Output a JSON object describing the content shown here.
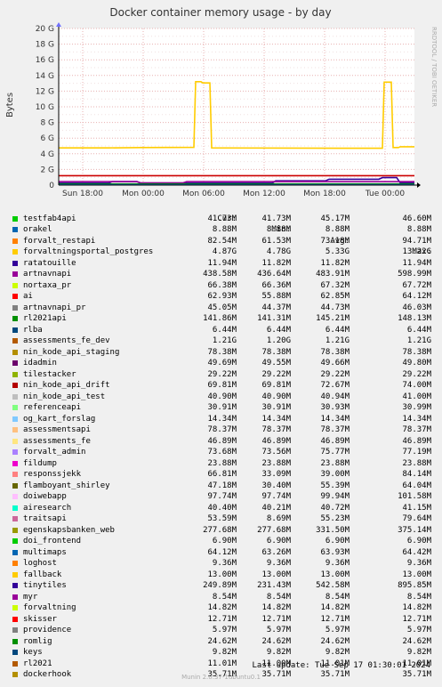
{
  "chart_data": {
    "type": "line",
    "title": "Docker container memory usage - by day",
    "ylabel": "Bytes",
    "side_label": "RRDTOOL / TOBI OETIKER",
    "ylim": [
      0,
      20
    ],
    "y_unit": "G",
    "y_ticks": [
      {
        "v": 0,
        "label": "0"
      },
      {
        "v": 2,
        "label": "2 G"
      },
      {
        "v": 4,
        "label": "4 G"
      },
      {
        "v": 6,
        "label": "6 G"
      },
      {
        "v": 8,
        "label": "8 G"
      },
      {
        "v": 10,
        "label": "10 G"
      },
      {
        "v": 12,
        "label": "12 G"
      },
      {
        "v": 14,
        "label": "14 G"
      },
      {
        "v": 16,
        "label": "16 G"
      },
      {
        "v": 18,
        "label": "18 G"
      },
      {
        "v": 20,
        "label": "20 G"
      }
    ],
    "x_range": [
      "Mon 15:30",
      "Tue 01:30"
    ],
    "x_ticks": [
      {
        "t": "Sun 18:00",
        "label": "Sun 18:00"
      },
      {
        "t": "Mon 00:00",
        "label": "Mon 00:00"
      },
      {
        "t": "Mon 06:00",
        "label": "Mon 06:00"
      },
      {
        "t": "Mon 12:00",
        "label": "Mon 12:00"
      },
      {
        "t": "Mon 18:00",
        "label": "Mon 18:00"
      },
      {
        "t": "Tue 00:00",
        "label": "Tue 00:00"
      }
    ],
    "series": [
      {
        "name": "forvaltningsportal_postgres",
        "color": "#ffcc00",
        "points": [
          [
            0,
            4.75
          ],
          [
            0.14,
            4.75
          ],
          [
            0.23,
            4.8
          ],
          [
            0.38,
            4.82
          ],
          [
            0.385,
            13.2
          ],
          [
            0.4,
            13.2
          ],
          [
            0.405,
            13.05
          ],
          [
            0.425,
            13.05
          ],
          [
            0.43,
            4.75
          ],
          [
            0.8,
            4.7
          ],
          [
            0.91,
            4.7
          ],
          [
            0.915,
            13.15
          ],
          [
            0.935,
            13.15
          ],
          [
            0.94,
            4.8
          ],
          [
            0.955,
            4.8
          ],
          [
            0.96,
            4.9
          ],
          [
            1,
            4.9
          ]
        ]
      },
      {
        "name": "romlig",
        "color": "#cc0000",
        "points": [
          [
            0,
            1.21
          ],
          [
            1,
            1.21
          ]
        ]
      },
      {
        "name": "tinytiles",
        "color": "#330099",
        "points": [
          [
            0,
            0.25
          ],
          [
            0.14,
            0.25
          ],
          [
            0.15,
            0.45
          ],
          [
            0.22,
            0.45
          ],
          [
            0.23,
            0.25
          ],
          [
            0.6,
            0.25
          ],
          [
            0.61,
            0.55
          ],
          [
            0.75,
            0.55
          ],
          [
            0.76,
            0.75
          ],
          [
            0.9,
            0.75
          ],
          [
            0.91,
            0.95
          ],
          [
            0.95,
            0.95
          ],
          [
            0.96,
            0.3
          ],
          [
            1,
            0.3
          ]
        ]
      },
      {
        "name": "artnavnapi",
        "color": "#990099",
        "points": [
          [
            0,
            0.44
          ],
          [
            0.22,
            0.44
          ],
          [
            0.23,
            0.3
          ],
          [
            0.35,
            0.3
          ],
          [
            0.36,
            0.44
          ],
          [
            1,
            0.44
          ]
        ]
      },
      {
        "name": "rl2021api",
        "color": "#008000",
        "points": [
          [
            0,
            0.15
          ],
          [
            1,
            0.15
          ]
        ]
      },
      {
        "name": "orakel",
        "color": "#0066b3",
        "points": [
          [
            0,
            0.05
          ],
          [
            1,
            0.05
          ]
        ]
      }
    ],
    "legend": {
      "headers": [
        "Cur:",
        "Min:",
        "Avg:",
        "Max:"
      ],
      "rows": [
        {
          "name": "testfab4api",
          "color": "#00cc00",
          "cur": "41.73M",
          "min": "41.73M",
          "avg": "45.17M",
          "max": "46.60M"
        },
        {
          "name": "orakel",
          "color": "#0066b3",
          "cur": "8.88M",
          "min": "8.88M",
          "avg": "8.88M",
          "max": "8.88M"
        },
        {
          "name": "forvalt_restapi",
          "color": "#ff8000",
          "cur": "82.54M",
          "min": "61.53M",
          "avg": "73.18M",
          "max": "94.71M"
        },
        {
          "name": "forvaltningsportal_postgres",
          "color": "#ffcc00",
          "cur": "4.87G",
          "min": "4.78G",
          "avg": "5.33G",
          "max": "13.22G"
        },
        {
          "name": "ratatouille",
          "color": "#330099",
          "cur": "11.94M",
          "min": "11.82M",
          "avg": "11.82M",
          "max": "11.94M"
        },
        {
          "name": "artnavnapi",
          "color": "#990099",
          "cur": "438.58M",
          "min": "436.64M",
          "avg": "483.91M",
          "max": "598.99M"
        },
        {
          "name": "nortaxa_pr",
          "color": "#ccff00",
          "cur": "66.38M",
          "min": "66.36M",
          "avg": "67.32M",
          "max": "67.72M"
        },
        {
          "name": "ai",
          "color": "#ff0000",
          "cur": "62.93M",
          "min": "55.88M",
          "avg": "62.85M",
          "max": "64.12M"
        },
        {
          "name": "artnavnapi_pr",
          "color": "#808080",
          "cur": "45.05M",
          "min": "44.37M",
          "avg": "44.73M",
          "max": "46.03M"
        },
        {
          "name": "rl2021api",
          "color": "#008f00",
          "cur": "141.86M",
          "min": "141.31M",
          "avg": "145.21M",
          "max": "148.13M"
        },
        {
          "name": "rlba",
          "color": "#00487d",
          "cur": "6.44M",
          "min": "6.44M",
          "avg": "6.44M",
          "max": "6.44M"
        },
        {
          "name": "assessments_fe_dev",
          "color": "#b35a00",
          "cur": "1.21G",
          "min": "1.20G",
          "avg": "1.21G",
          "max": "1.21G"
        },
        {
          "name": "nin_kode_api_staging",
          "color": "#b38f00",
          "cur": "78.38M",
          "min": "78.38M",
          "avg": "78.38M",
          "max": "78.38M"
        },
        {
          "name": "idadmin",
          "color": "#6b006b",
          "cur": "49.69M",
          "min": "49.55M",
          "avg": "49.66M",
          "max": "49.80M"
        },
        {
          "name": "tilestacker",
          "color": "#8fb300",
          "cur": "29.22M",
          "min": "29.22M",
          "avg": "29.22M",
          "max": "29.22M"
        },
        {
          "name": "nin_kode_api_drift",
          "color": "#b30000",
          "cur": "69.81M",
          "min": "69.81M",
          "avg": "72.67M",
          "max": "74.00M"
        },
        {
          "name": "nin_kode_api_test",
          "color": "#bebebe",
          "cur": "40.90M",
          "min": "40.90M",
          "avg": "40.94M",
          "max": "41.00M"
        },
        {
          "name": "referenceapi",
          "color": "#80ff80",
          "cur": "30.91M",
          "min": "30.91M",
          "avg": "30.93M",
          "max": "30.99M"
        },
        {
          "name": "og_kart_forslag",
          "color": "#80c9ff",
          "cur": "14.34M",
          "min": "14.34M",
          "avg": "14.34M",
          "max": "14.34M"
        },
        {
          "name": "assessmentsapi",
          "color": "#ffc080",
          "cur": "78.37M",
          "min": "78.37M",
          "avg": "78.37M",
          "max": "78.37M"
        },
        {
          "name": "assessments_fe",
          "color": "#ffe680",
          "cur": "46.89M",
          "min": "46.89M",
          "avg": "46.89M",
          "max": "46.89M"
        },
        {
          "name": "forvalt_admin",
          "color": "#aa80ff",
          "cur": "73.68M",
          "min": "73.56M",
          "avg": "75.77M",
          "max": "77.19M"
        },
        {
          "name": "fildump",
          "color": "#ee00cc",
          "cur": "23.88M",
          "min": "23.88M",
          "avg": "23.88M",
          "max": "23.88M"
        },
        {
          "name": "responssjekk",
          "color": "#ff8080",
          "cur": "66.81M",
          "min": "33.09M",
          "avg": "39.00M",
          "max": "84.14M"
        },
        {
          "name": "flamboyant_shirley",
          "color": "#666600",
          "cur": "47.18M",
          "min": "30.40M",
          "avg": "55.39M",
          "max": "64.04M"
        },
        {
          "name": "doiwebapp",
          "color": "#ffbfff",
          "cur": "97.74M",
          "min": "97.74M",
          "avg": "99.94M",
          "max": "101.58M"
        },
        {
          "name": "airesearch",
          "color": "#00ffcc",
          "cur": "40.40M",
          "min": "40.21M",
          "avg": "40.72M",
          "max": "41.15M"
        },
        {
          "name": "traitsapi",
          "color": "#cc6699",
          "cur": "53.59M",
          "min": "8.69M",
          "avg": "55.23M",
          "max": "79.64M"
        },
        {
          "name": "egenskapsbanken_web",
          "color": "#999900",
          "cur": "277.68M",
          "min": "277.68M",
          "avg": "331.50M",
          "max": "375.14M"
        },
        {
          "name": "doi_frontend",
          "color": "#00cc00",
          "cur": "6.90M",
          "min": "6.90M",
          "avg": "6.90M",
          "max": "6.90M"
        },
        {
          "name": "multimaps",
          "color": "#0066b3",
          "cur": "64.12M",
          "min": "63.26M",
          "avg": "63.93M",
          "max": "64.42M"
        },
        {
          "name": "loghost",
          "color": "#ff8000",
          "cur": "9.36M",
          "min": "9.36M",
          "avg": "9.36M",
          "max": "9.36M"
        },
        {
          "name": "fallback",
          "color": "#ffcc00",
          "cur": "13.00M",
          "min": "13.00M",
          "avg": "13.00M",
          "max": "13.00M"
        },
        {
          "name": "tinytiles",
          "color": "#330099",
          "cur": "249.89M",
          "min": "231.43M",
          "avg": "542.58M",
          "max": "895.85M"
        },
        {
          "name": "myr",
          "color": "#990099",
          "cur": "8.54M",
          "min": "8.54M",
          "avg": "8.54M",
          "max": "8.54M"
        },
        {
          "name": "forvaltning",
          "color": "#ccff00",
          "cur": "14.82M",
          "min": "14.82M",
          "avg": "14.82M",
          "max": "14.82M"
        },
        {
          "name": "skisser",
          "color": "#ff0000",
          "cur": "12.71M",
          "min": "12.71M",
          "avg": "12.71M",
          "max": "12.71M"
        },
        {
          "name": "providence",
          "color": "#808080",
          "cur": "5.97M",
          "min": "5.97M",
          "avg": "5.97M",
          "max": "5.97M"
        },
        {
          "name": "romlig",
          "color": "#008f00",
          "cur": "24.62M",
          "min": "24.62M",
          "avg": "24.62M",
          "max": "24.62M"
        },
        {
          "name": "keys",
          "color": "#00487d",
          "cur": "9.82M",
          "min": "9.82M",
          "avg": "9.82M",
          "max": "9.82M"
        },
        {
          "name": "rl2021",
          "color": "#b35a00",
          "cur": "11.01M",
          "min": "11.00M",
          "avg": "11.01M",
          "max": "11.01M"
        },
        {
          "name": "dockerhook",
          "color": "#b38f00",
          "cur": "35.71M",
          "min": "35.71M",
          "avg": "35.71M",
          "max": "35.71M"
        }
      ]
    }
  },
  "footer": {
    "last_update": "Last update: Tue Sep 17 01:30:01 2024",
    "version": "Munin 2.0.37-1ubuntu0.1"
  }
}
